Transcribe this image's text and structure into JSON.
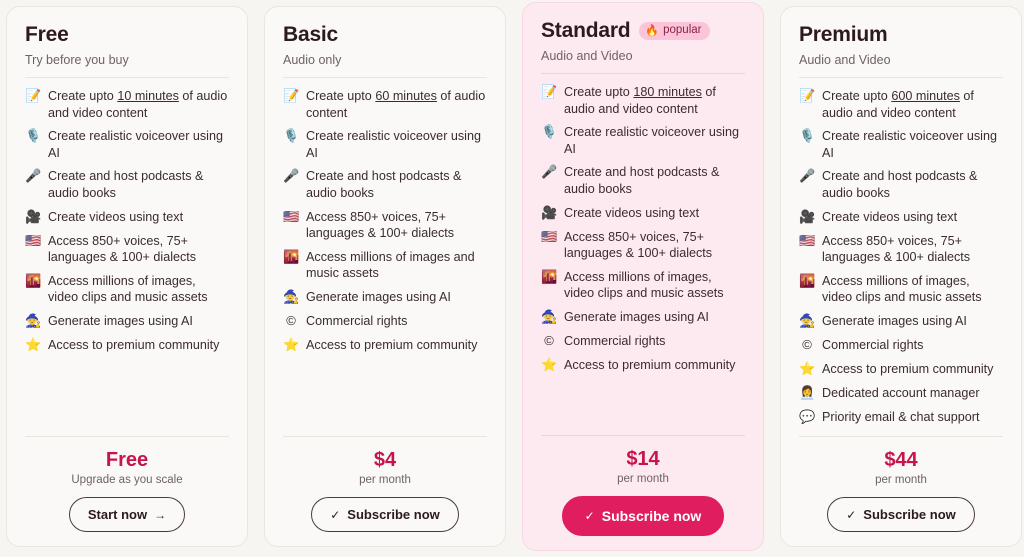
{
  "theme": {
    "page_background": "#f7f5f1",
    "card_background": "#faf9f7",
    "highlight_card_background": "#fdeaf1",
    "accent": "#c8134b",
    "cta_solid": "#e01e5f",
    "badge_background": "#fbc4d8"
  },
  "plans": [
    {
      "name": "Free",
      "subtitle": "Try before you buy",
      "badge": null,
      "features": [
        {
          "icon": "memo-icon",
          "glyph": "📝",
          "text_before": "Create upto ",
          "emphasis": "10 minutes",
          "text_after": " of audio and video content"
        },
        {
          "icon": "studio-microphone-icon",
          "glyph": "🎙️",
          "text": "Create realistic voiceover using AI"
        },
        {
          "icon": "microphone-icon",
          "glyph": "🎤",
          "text": "Create and host podcasts & audio books"
        },
        {
          "icon": "movie-camera-icon",
          "glyph": "🎥",
          "text": "Create videos using text"
        },
        {
          "icon": "flag-icon",
          "glyph": "🇺🇸",
          "text": "Access 850+ voices, 75+ languages & 100+ dialects"
        },
        {
          "icon": "cityscape-icon",
          "glyph": "🌇",
          "text": "Access millions of images, video clips and music assets"
        },
        {
          "icon": "mage-icon",
          "glyph": "🧙",
          "text": "Generate images using AI"
        },
        {
          "icon": "star-icon",
          "glyph": "⭐",
          "text": "Access to premium community"
        }
      ],
      "price": "Free",
      "price_sub": "Upgrade as you scale",
      "cta_label": "Start now",
      "cta_glyph": "→",
      "cta_glyph_name": "arrow-right-icon",
      "cta_style": "outline",
      "cta_icon_position": "after"
    },
    {
      "name": "Basic",
      "subtitle": "Audio only",
      "badge": null,
      "features": [
        {
          "icon": "memo-icon",
          "glyph": "📝",
          "text_before": "Create upto ",
          "emphasis": "60 minutes",
          "text_after": " of audio content"
        },
        {
          "icon": "studio-microphone-icon",
          "glyph": "🎙️",
          "text": "Create realistic voiceover using AI"
        },
        {
          "icon": "microphone-icon",
          "glyph": "🎤",
          "text": "Create and host podcasts & audio books"
        },
        {
          "icon": "flag-icon",
          "glyph": "🇺🇸",
          "text": "Access 850+ voices, 75+ languages & 100+ dialects"
        },
        {
          "icon": "cityscape-icon",
          "glyph": "🌇",
          "text": "Access millions of images and music assets"
        },
        {
          "icon": "mage-icon",
          "glyph": "🧙",
          "text": "Generate images using AI"
        },
        {
          "icon": "copyright-icon",
          "glyph": "©",
          "text": "Commercial rights"
        },
        {
          "icon": "star-icon",
          "glyph": "⭐",
          "text": "Access to premium community"
        }
      ],
      "price": "$4",
      "price_sub": "per month",
      "cta_label": "Subscribe now",
      "cta_glyph": "✓",
      "cta_glyph_name": "check-icon",
      "cta_style": "outline",
      "cta_icon_position": "before"
    },
    {
      "name": "Standard",
      "subtitle": "Audio and Video",
      "badge": {
        "label": "popular",
        "glyph": "🔥",
        "icon": "fire-icon"
      },
      "features": [
        {
          "icon": "memo-icon",
          "glyph": "📝",
          "text_before": "Create upto ",
          "emphasis": "180 minutes",
          "text_after": " of audio and video content"
        },
        {
          "icon": "studio-microphone-icon",
          "glyph": "🎙️",
          "text": "Create realistic voiceover using AI"
        },
        {
          "icon": "microphone-icon",
          "glyph": "🎤",
          "text": "Create and host podcasts & audio books"
        },
        {
          "icon": "movie-camera-icon",
          "glyph": "🎥",
          "text": "Create videos using text"
        },
        {
          "icon": "flag-icon",
          "glyph": "🇺🇸",
          "text": "Access 850+ voices, 75+ languages & 100+ dialects"
        },
        {
          "icon": "cityscape-icon",
          "glyph": "🌇",
          "text": "Access millions of images, video clips and music assets"
        },
        {
          "icon": "mage-icon",
          "glyph": "🧙",
          "text": "Generate images using AI"
        },
        {
          "icon": "copyright-icon",
          "glyph": "©",
          "text": "Commercial rights"
        },
        {
          "icon": "star-icon",
          "glyph": "⭐",
          "text": "Access to premium community"
        }
      ],
      "price": "$14",
      "price_sub": "per month",
      "cta_label": "Subscribe now",
      "cta_glyph": "✓",
      "cta_glyph_name": "check-icon",
      "cta_style": "solid",
      "cta_icon_position": "before"
    },
    {
      "name": "Premium",
      "subtitle": "Audio and Video",
      "badge": null,
      "features": [
        {
          "icon": "memo-icon",
          "glyph": "📝",
          "text_before": "Create upto ",
          "emphasis": "600 minutes",
          "text_after": " of audio and video content"
        },
        {
          "icon": "studio-microphone-icon",
          "glyph": "🎙️",
          "text": "Create realistic voiceover using AI"
        },
        {
          "icon": "microphone-icon",
          "glyph": "🎤",
          "text": "Create and host podcasts & audio books"
        },
        {
          "icon": "movie-camera-icon",
          "glyph": "🎥",
          "text": "Create videos using text"
        },
        {
          "icon": "flag-icon",
          "glyph": "🇺🇸",
          "text": "Access 850+ voices, 75+ languages & 100+ dialects"
        },
        {
          "icon": "cityscape-icon",
          "glyph": "🌇",
          "text": "Access millions of images, video clips and music assets"
        },
        {
          "icon": "mage-icon",
          "glyph": "🧙",
          "text": "Generate images using AI"
        },
        {
          "icon": "copyright-icon",
          "glyph": "©",
          "text": "Commercial rights"
        },
        {
          "icon": "star-icon",
          "glyph": "⭐",
          "text": "Access to premium community"
        },
        {
          "icon": "account-manager-icon",
          "glyph": "👩‍💼",
          "text": "Dedicated account manager"
        },
        {
          "icon": "speech-balloon-icon",
          "glyph": "💬",
          "text": "Priority email & chat support"
        }
      ],
      "price": "$44",
      "price_sub": "per month",
      "cta_label": "Subscribe now",
      "cta_glyph": "✓",
      "cta_glyph_name": "check-icon",
      "cta_style": "outline",
      "cta_icon_position": "before"
    }
  ]
}
